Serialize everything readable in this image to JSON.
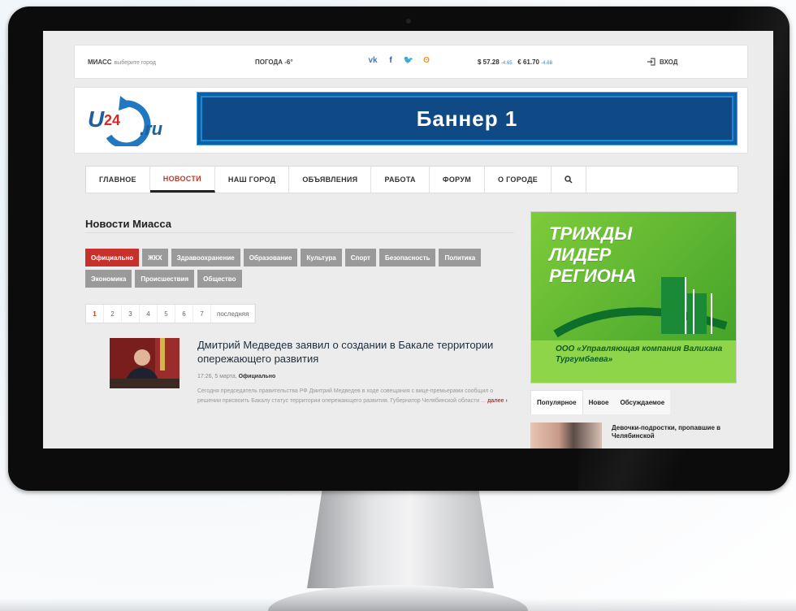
{
  "topbar": {
    "city": "МИАСС",
    "city_hint": "выберите город",
    "weather": "ПОГОДА -6°",
    "social": [
      {
        "icon": "vk-icon",
        "glyph": "vk",
        "color": "#4a76a8"
      },
      {
        "icon": "facebook-icon",
        "glyph": "f",
        "color": "#3b5998"
      },
      {
        "icon": "twitter-icon",
        "glyph": "🐦",
        "color": "#1da1f2"
      },
      {
        "icon": "odnoklassniki-icon",
        "glyph": "ʘ",
        "color": "#f7931e"
      }
    ],
    "usd": "$ 57.28",
    "usd_delta": "-4.65",
    "eur": "€ 61.70",
    "eur_delta": "-4.68",
    "login": "ВХОД"
  },
  "header": {
    "logo_main": "U24",
    "logo_suffix": ".ru",
    "banner": "Баннер 1"
  },
  "nav": {
    "items": [
      "ГЛАВНОЕ",
      "НОВОСТИ",
      "НАШ ГОРОД",
      "ОБЪЯВЛЕНИЯ",
      "РАБОТА",
      "ФОРУМ",
      "О ГОРОДЕ"
    ],
    "active_index": 1
  },
  "main": {
    "section_title": "Новости Миасса",
    "tags": [
      "Официально",
      "ЖКХ",
      "Здравоохранение",
      "Образование",
      "Культура",
      "Спорт",
      "Безопасность",
      "Политика",
      "Экономика",
      "Происшествия",
      "Общество"
    ],
    "active_tag": 0,
    "pages": [
      "1",
      "2",
      "3",
      "4",
      "5",
      "6",
      "7",
      "последняя"
    ],
    "active_page": 0,
    "article": {
      "title": "Дмитрий Медведев заявил о создании в Бакале территории опережающего развития",
      "time": "17:26, 5 марта,",
      "category": "Официально",
      "text": "Сегодня председатель правительства РФ Дмитрий Медведев в ходе совещания с вице-премьерами сообщил о решении присвоить Бакалу статус территории опережающего развития. Губернатор Челябинской области ...",
      "more": "далее"
    }
  },
  "sidebar": {
    "ad_title_lines": [
      "ТРИЖДЫ",
      "ЛИДЕР",
      "РЕГИОНА"
    ],
    "ad_footer": "ООО «Управляющая компания Валихана Тургумбаева»",
    "tabs": [
      "Популярное",
      "Новое",
      "Обсуждаемое"
    ],
    "active_tab": 0,
    "item_text": "Девочки-подростки, пропавшие в Челябинской"
  }
}
